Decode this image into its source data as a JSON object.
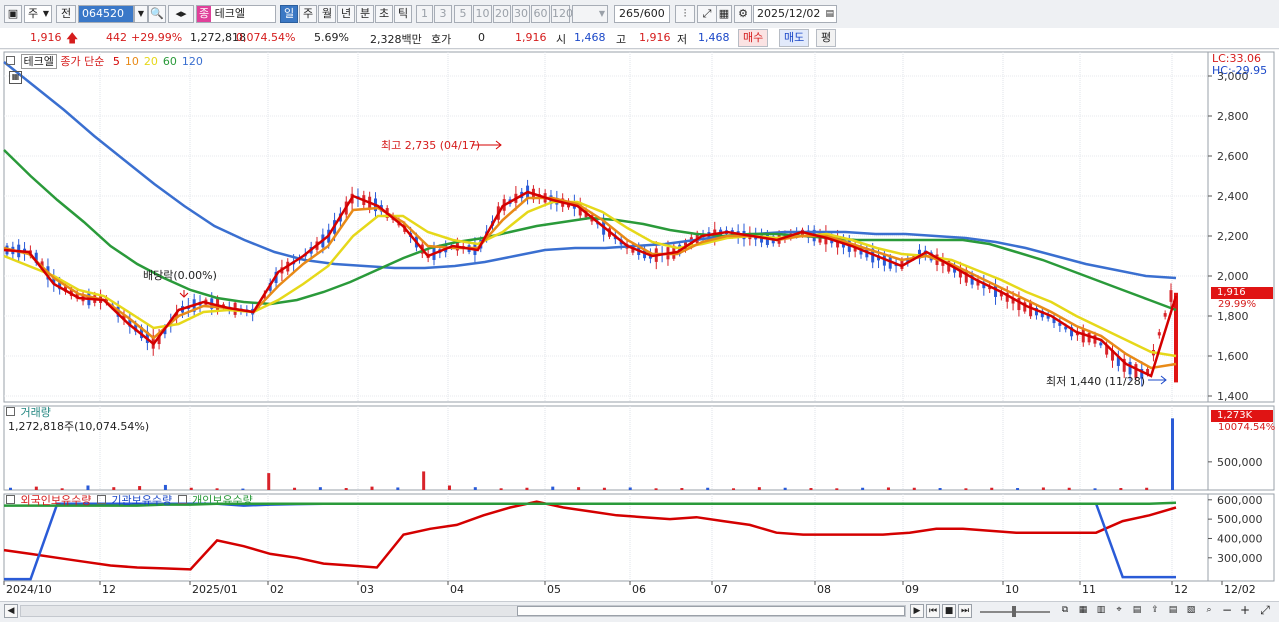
{
  "toolbar": {
    "type_label": "주",
    "prev_label": "전",
    "code": "064520",
    "badge": "종",
    "name": "테크엘",
    "periods": [
      "일",
      "주",
      "월",
      "년",
      "분",
      "초",
      "틱"
    ],
    "intervals": [
      "1",
      "3",
      "5",
      "10",
      "20",
      "30",
      "60",
      "120"
    ],
    "count": "265",
    "count_total": "/600",
    "date": "2025/12/02"
  },
  "quote": {
    "price": "1,916",
    "change": "442",
    "change_pct": "+29.99%",
    "volume": "1,272,818",
    "volume_ratio": "0,074.54%",
    "turnover": "5.69%",
    "amount": "2,328백만",
    "hoga_label": "호가",
    "hoga_value": "0",
    "hoga_price": "1,916",
    "open_label": "시",
    "open": "1,468",
    "high_label": "고",
    "high": "1,916",
    "low_label": "저",
    "low": "1,468",
    "buy_label": "매수",
    "sell_label": "매도",
    "avg_label": "평"
  },
  "legend": {
    "name": "테크엘",
    "ma_label": "종가 단순",
    "periods": [
      "5",
      "10",
      "20",
      "60",
      "120"
    ],
    "colors": [
      "#d40000",
      "#e88a17",
      "#e6d81a",
      "#2a9a3a",
      "#3a6fd0"
    ],
    "lc": "LC:33.06",
    "hc": "HC:-29.95"
  },
  "annotations": {
    "high": "최고 2,735 (04/17)",
    "low": "최저 1,440 (11/28)",
    "dividend": "배당락(0.00%)",
    "price_tag": "1,916",
    "price_pct": "29.99%",
    "volume_tag": "1,273K",
    "volume_pct": "10074.54%"
  },
  "volume_panel": {
    "title": "거래량",
    "summary": "1,272,818주(10,074.54%)"
  },
  "holdings_panel": {
    "series": [
      "외국인보유수량",
      "기관보유수량",
      "개인보유수량"
    ]
  },
  "chart_data": [
    {
      "type": "line",
      "panel": "price",
      "y_ticks": [
        3000,
        2800,
        2600,
        2400,
        2200,
        2000,
        1800,
        1600,
        1400
      ],
      "ylim": [
        1370,
        3120
      ],
      "x_months": [
        "2024/10",
        "12",
        "2025/01",
        "02",
        "03",
        "04",
        "05",
        "06",
        "07",
        "08",
        "09",
        "10",
        "11",
        "12",
        "12/02"
      ],
      "series": [
        {
          "name": "5",
          "values": [
            2130,
            2120,
            1960,
            1890,
            1880,
            1760,
            1660,
            1830,
            1870,
            1840,
            1820,
            2020,
            2100,
            2200,
            2400,
            2350,
            2250,
            2100,
            2150,
            2130,
            2350,
            2420,
            2380,
            2350,
            2250,
            2150,
            2100,
            2120,
            2200,
            2220,
            2200,
            2180,
            2220,
            2190,
            2150,
            2100,
            2050,
            2120,
            2050,
            1980,
            1920,
            1850,
            1800,
            1720,
            1680,
            1560,
            1500,
            1900
          ]
        },
        {
          "name": "10",
          "values": [
            2140,
            2110,
            1990,
            1910,
            1880,
            1790,
            1690,
            1800,
            1850,
            1840,
            1820,
            1950,
            2060,
            2150,
            2330,
            2340,
            2270,
            2150,
            2140,
            2140,
            2280,
            2390,
            2390,
            2360,
            2280,
            2180,
            2110,
            2110,
            2170,
            2200,
            2200,
            2180,
            2200,
            2200,
            2160,
            2120,
            2080,
            2100,
            2060,
            2000,
            1940,
            1880,
            1820,
            1750,
            1700,
            1610,
            1540,
            1560
          ]
        },
        {
          "name": "20",
          "values": [
            2100,
            2050,
            2000,
            1930,
            1900,
            1820,
            1740,
            1760,
            1820,
            1830,
            1820,
            1880,
            1960,
            2050,
            2200,
            2300,
            2300,
            2220,
            2180,
            2160,
            2220,
            2320,
            2370,
            2370,
            2320,
            2240,
            2170,
            2140,
            2160,
            2190,
            2200,
            2190,
            2200,
            2210,
            2180,
            2140,
            2110,
            2100,
            2080,
            2030,
            1980,
            1920,
            1870,
            1800,
            1740,
            1680,
            1620,
            1600
          ]
        },
        {
          "name": "60",
          "values": [
            2630,
            2500,
            2380,
            2270,
            2150,
            2060,
            1990,
            1930,
            1890,
            1870,
            1860,
            1880,
            1920,
            1970,
            2030,
            2090,
            2140,
            2170,
            2190,
            2220,
            2250,
            2270,
            2290,
            2280,
            2260,
            2230,
            2210,
            2200,
            2210,
            2210,
            2200,
            2190,
            2180,
            2180,
            2180,
            2180,
            2180,
            2160,
            2120,
            2080,
            2030,
            1980,
            1930,
            1880,
            1830
          ]
        },
        {
          "name": "120",
          "values": [
            3070,
            2950,
            2830,
            2700,
            2580,
            2460,
            2350,
            2250,
            2180,
            2120,
            2080,
            2060,
            2050,
            2040,
            2040,
            2050,
            2070,
            2100,
            2130,
            2140,
            2140,
            2150,
            2160,
            2180,
            2200,
            2210,
            2220,
            2220,
            2220,
            2210,
            2210,
            2200,
            2190,
            2170,
            2140,
            2100,
            2060,
            2030,
            2000,
            1990
          ]
        }
      ]
    },
    {
      "type": "bar",
      "panel": "volume",
      "y_ticks": [
        500000
      ],
      "values": [
        40000,
        60000,
        30000,
        80000,
        50000,
        70000,
        90000,
        40000,
        30000,
        25000,
        300000,
        40000,
        50000,
        35000,
        60000,
        45000,
        330000,
        80000,
        50000,
        30000,
        40000,
        60000,
        50000,
        40000,
        45000,
        30000,
        35000,
        40000,
        30000,
        50000,
        40000,
        35000,
        30000,
        40000,
        45000,
        40000,
        35000,
        30000,
        40000,
        35000,
        45000,
        40000,
        30000,
        35000,
        40000,
        1272818
      ]
    },
    {
      "type": "line",
      "panel": "holdings",
      "y_ticks": [
        600000,
        500000,
        400000,
        300000
      ],
      "ylim": [
        180000,
        630000
      ],
      "series": [
        {
          "name": "외국인보유수량",
          "values": [
            340000,
            320000,
            300000,
            280000,
            260000,
            250000,
            245000,
            240000,
            390000,
            360000,
            320000,
            300000,
            270000,
            260000,
            250000,
            420000,
            450000,
            470000,
            520000,
            560000,
            590000,
            560000,
            540000,
            520000,
            510000,
            500000,
            510000,
            490000,
            470000,
            430000,
            420000,
            420000,
            420000,
            420000,
            430000,
            450000,
            450000,
            440000,
            430000,
            430000,
            430000,
            430000,
            490000,
            520000,
            560000
          ]
        },
        {
          "name": "기관보유수량",
          "values": [
            190000,
            190000,
            580000,
            580000,
            580000,
            580000,
            580000,
            580000,
            580000,
            570000,
            575000,
            578000,
            580000,
            580000,
            580000,
            580000,
            580000,
            580000,
            580000,
            580000,
            580000,
            580000,
            580000,
            580000,
            580000,
            580000,
            580000,
            580000,
            580000,
            580000,
            580000,
            580000,
            580000,
            580000,
            580000,
            580000,
            580000,
            580000,
            580000,
            580000,
            580000,
            580000,
            200000,
            200000,
            200000
          ]
        },
        {
          "name": "개인보유수량",
          "values": [
            570000,
            570000,
            570000,
            570000,
            570000,
            570000,
            575000,
            575000,
            580000,
            580000,
            580000,
            580000,
            580000,
            580000,
            580000,
            580000,
            580000,
            580000,
            580000,
            580000,
            580000,
            580000,
            580000,
            580000,
            580000,
            580000,
            580000,
            580000,
            580000,
            580000,
            580000,
            580000,
            580000,
            580000,
            580000,
            580000,
            580000,
            580000,
            580000,
            580000,
            580000,
            580000,
            580000,
            580000,
            585000
          ]
        }
      ]
    }
  ]
}
